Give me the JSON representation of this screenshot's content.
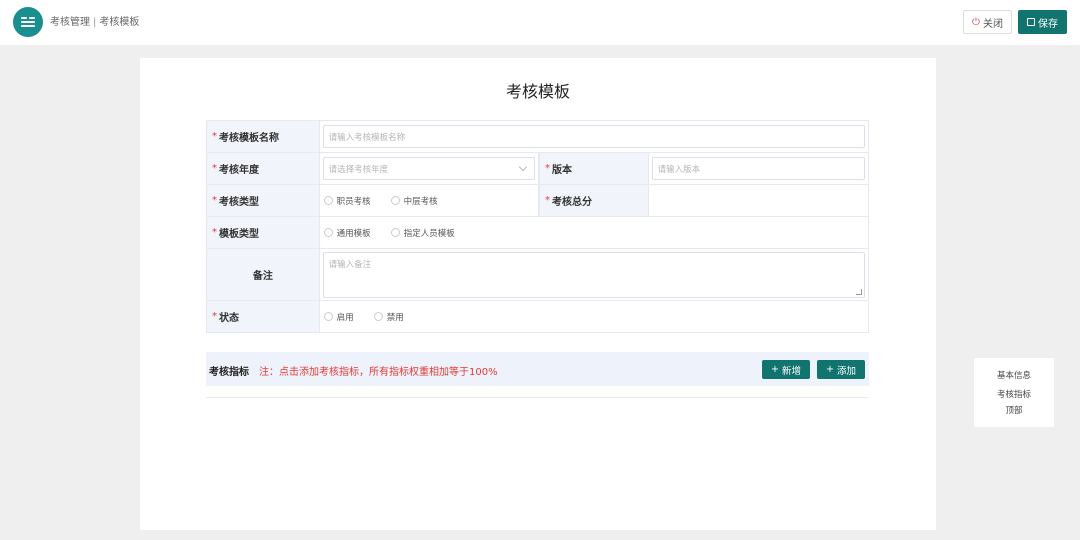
{
  "header": {
    "breadcrumb_module": "考核管理",
    "breadcrumb_sep": "|",
    "breadcrumb_page": "考核模板",
    "close_label": "关闭",
    "save_label": "保存",
    "close_icon": "power-icon",
    "save_icon": "floppy-disk-icon"
  },
  "form": {
    "title": "考核模板",
    "required_mark": "*",
    "name_label": "考核模板名称",
    "name_placeholder": "请输入考核模板名称",
    "year_label": "考核年度",
    "year_placeholder": "请选择考核年度",
    "version_label": "版本",
    "version_placeholder": "请输入版本",
    "type_label": "考核类型",
    "type_options": [
      "职员考核",
      "中层考核"
    ],
    "total_label": "考核总分",
    "template_type_label": "模板类型",
    "template_type_options": [
      "通用模板",
      "指定人员模板"
    ],
    "remark_label": "备注",
    "remark_placeholder": "请输入备注",
    "status_label": "状态",
    "status_options": [
      "启用",
      "禁用"
    ]
  },
  "indicator": {
    "title": "考核指标",
    "note": "注：点击添加考核指标，所有指标权重相加等于100%",
    "new_label": "新增",
    "add_label": "添加"
  },
  "side_nav": {
    "items": [
      "基本信息",
      "考核指标",
      "顶部"
    ]
  },
  "colors": {
    "primary": "#12746f",
    "required": "#e0393e",
    "note": "#e53935",
    "label_bg": "#f1f4fa"
  }
}
